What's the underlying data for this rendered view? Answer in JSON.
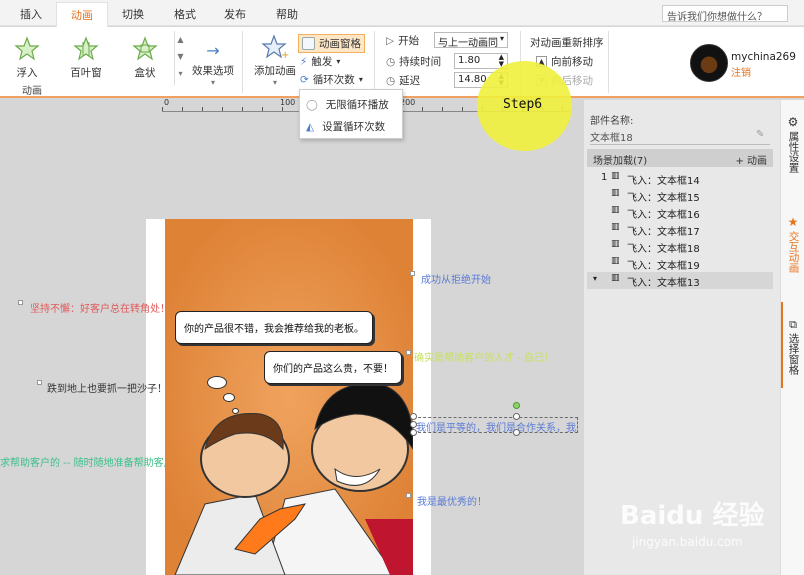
{
  "tabs": [
    "插入",
    "动画",
    "切换",
    "格式",
    "发布",
    "帮助"
  ],
  "active_tab": "动画",
  "search_placeholder": "告诉我们你想做什么？",
  "ribbon": {
    "effects": [
      {
        "label": "浮入",
        "icon": "star-float-icon"
      },
      {
        "label": "百叶窗",
        "icon": "star-blinds-icon"
      },
      {
        "label": "盒状",
        "icon": "star-box-icon"
      }
    ],
    "effect_options_label": "效果选项",
    "group_animation_label": "动画",
    "add_animation_label": "添加动画",
    "animation_pane_label": "动画窗格",
    "trigger_label": "触发",
    "loop_label": "循环次数",
    "start_label": "开始",
    "start_value": "与上一动画同",
    "duration_label": "持续时间",
    "duration_value": "1.80",
    "delay_label": "延迟",
    "delay_value": "14.80",
    "reorder_title": "对动画重新排序",
    "move_forward_label": "向前移动",
    "move_backward_label": "向后移动"
  },
  "user": {
    "name": "mychina269",
    "logout": "注销"
  },
  "dropdown": {
    "items": [
      "无限循环播放",
      "设置循环次数"
    ]
  },
  "step_label": "Step6",
  "canvas": {
    "bubble_1": "你的产品很不错，我会推荐给我的老板。",
    "bubble_2": "你们的产品这么贵，不要！",
    "floating_texts": [
      {
        "text": "坚持不懈：好客户总在转角处！",
        "color": "#e05a5a"
      },
      {
        "text": "跌到地上也要抓一把沙子！",
        "color": "#333333"
      },
      {
        "text": "求帮助客户的 -- 随时随地准备帮助客户！",
        "color": "#3cbf8a"
      },
      {
        "text": "成功从拒绝开始",
        "color": "#5a7bd6"
      },
      {
        "text": "确实是帮助客户的人才 - 自己！",
        "color": "#c8e060"
      },
      {
        "text": "我们是平等的，我们是合作关系，我们",
        "color": "#5a7bd6"
      },
      {
        "text": "我是最优秀的！",
        "color": "#5a7bd6"
      }
    ]
  },
  "panel": {
    "component_name_label": "部件名称:",
    "component_name_value": "文本框18",
    "scene_load_label": "场景加载(7)",
    "add_animation_link": "+ 动画",
    "animations": [
      {
        "index": "1",
        "text": "飞入：文本框14"
      },
      {
        "index": "",
        "text": "飞入：文本框15"
      },
      {
        "index": "",
        "text": "飞入：文本框16"
      },
      {
        "index": "",
        "text": "飞入：文本框17"
      },
      {
        "index": "",
        "text": "飞入：文本框18"
      },
      {
        "index": "",
        "text": "飞入：文本框19"
      },
      {
        "index": "",
        "text": "飞入：文本框13"
      }
    ]
  },
  "side_tabs": [
    "属性设置",
    "交互动画",
    "选择窗格"
  ],
  "watermark": {
    "main": "Baidu 经验",
    "sub": "jingyan.baidu.com"
  }
}
